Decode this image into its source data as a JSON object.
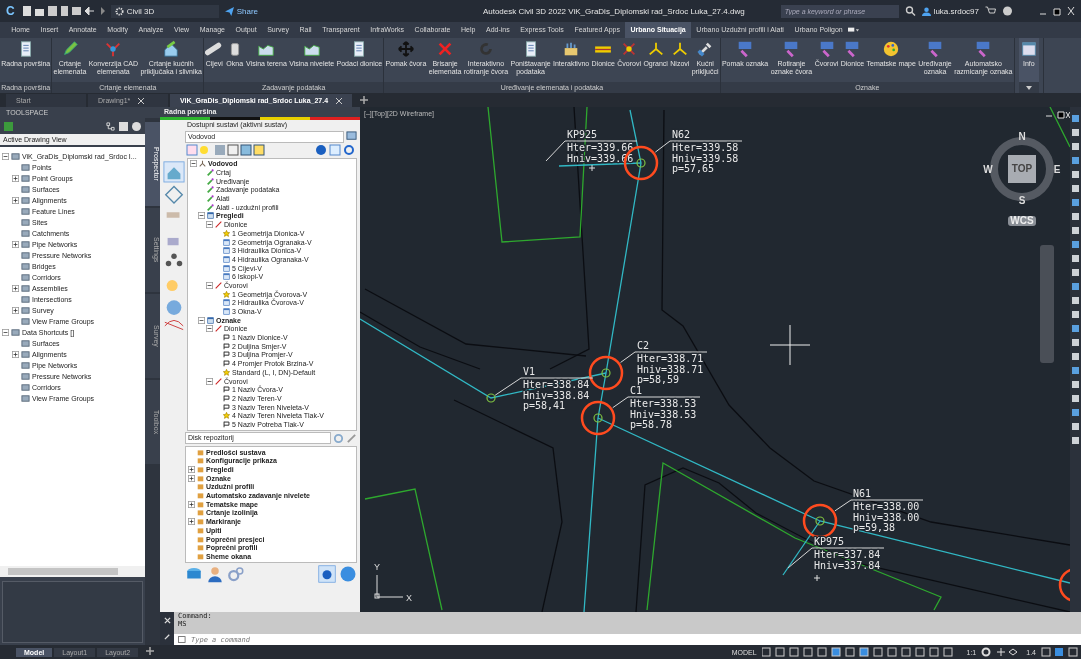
{
  "title_bar": {
    "app_badge": "C",
    "workspace": "Civil 3D",
    "share": "Share",
    "title": "Autodesk Civil 3D 2022   ViK_GraDis_Diplomski rad_Srdoc Luka_27.4.dwg",
    "search": {
      "placeholder": "Type a keyword or phrase"
    },
    "user": "luka.srdoc97"
  },
  "ribbon_tabs": [
    {
      "label": "Home",
      "selected": false
    },
    {
      "label": "Insert",
      "selected": false
    },
    {
      "label": "Annotate",
      "selected": false
    },
    {
      "label": "Modify",
      "selected": false
    },
    {
      "label": "Analyze",
      "selected": false
    },
    {
      "label": "View",
      "selected": false
    },
    {
      "label": "Manage",
      "selected": false
    },
    {
      "label": "Output",
      "selected": false
    },
    {
      "label": "Survey",
      "selected": false
    },
    {
      "label": "Rail",
      "selected": false
    },
    {
      "label": "Transparent",
      "selected": false
    },
    {
      "label": "InfraWorks",
      "selected": false
    },
    {
      "label": "Collaborate",
      "selected": false
    },
    {
      "label": "Help",
      "selected": false
    },
    {
      "label": "Add-ins",
      "selected": false
    },
    {
      "label": "Express Tools",
      "selected": false
    },
    {
      "label": "Featured Apps",
      "selected": false
    },
    {
      "label": "Urbano Situacija",
      "selected": true
    },
    {
      "label": "Urbano Uzdužni profili i Alati",
      "selected": false
    },
    {
      "label": "Urbano Poligon",
      "selected": false
    }
  ],
  "ribbon_panels": [
    {
      "title": "Radna površina",
      "buttons": [
        "Radna površina"
      ]
    },
    {
      "title": "Crtanje elemenata",
      "buttons": [
        "Crtanje\nelemenata",
        "Konverzija CAD\nelemenata",
        "Crtanje kućnih\npriključaka i slivnika"
      ]
    },
    {
      "title": "Zadavanje podataka",
      "buttons": [
        "Cijevi",
        "Okna",
        "Visina terena",
        "Visina nivelete",
        "Podaci dionice"
      ]
    },
    {
      "title": "Uređivanje elemenata i podataka",
      "buttons": [
        "Pomak čvora",
        "Brisanje\nelemenata",
        "Interaktivno\nrotiranje čvora",
        "Poništavanje\npodataka",
        "Interaktivno",
        "Dionice",
        "Čvorovi",
        "Ogranci",
        "Nizovi",
        "Kućni\npriključci"
      ]
    },
    {
      "title": "Oznake",
      "buttons": [
        "Pomak oznaka",
        "Rotiranje\noznake čvora",
        "Čvorovi",
        "Dionice",
        "Tematske mape",
        "Uređivanje\noznaka",
        "Automatsko\nrazmicanje oznaka"
      ]
    }
  ],
  "info_button": "Info",
  "document_tabs": [
    {
      "label": "Start",
      "selected": false,
      "closable": false
    },
    {
      "label": "Drawing1*",
      "selected": false,
      "closable": true
    },
    {
      "label": "ViK_GraDis_Diplomski rad_Srdoc Luka_27.4",
      "selected": true,
      "closable": true
    }
  ],
  "toolspace": {
    "title": "TOOLSPACE",
    "view": "Active Drawing View",
    "tree": [
      {
        "label": "ViK_GraDis_Diplomski rad_Srdoc I...",
        "collapsed": false,
        "children": [
          {
            "label": "Points",
            "collapsed": false
          },
          {
            "label": "Point Groups",
            "collapsed": true
          },
          {
            "label": "Surfaces",
            "collapsed": false
          },
          {
            "label": "Alignments",
            "collapsed": true
          },
          {
            "label": "Feature Lines",
            "collapsed": false
          },
          {
            "label": "Sites",
            "collapsed": false
          },
          {
            "label": "Catchments",
            "collapsed": false
          },
          {
            "label": "Pipe Networks",
            "collapsed": true
          },
          {
            "label": "Pressure Networks",
            "collapsed": false
          },
          {
            "label": "Bridges",
            "collapsed": false
          },
          {
            "label": "Corridors",
            "collapsed": false
          },
          {
            "label": "Assemblies",
            "collapsed": true
          },
          {
            "label": "Intersections",
            "collapsed": false
          },
          {
            "label": "Survey",
            "collapsed": true
          },
          {
            "label": "View Frame Groups",
            "collapsed": false
          }
        ]
      },
      {
        "label": "Data Shortcuts []",
        "collapsed": false,
        "children": [
          {
            "label": "Surfaces",
            "collapsed": false
          },
          {
            "label": "Alignments",
            "collapsed": true
          },
          {
            "label": "Pipe Networks",
            "collapsed": false
          },
          {
            "label": "Pressure Networks",
            "collapsed": false
          },
          {
            "label": "Corridors",
            "collapsed": false
          },
          {
            "label": "View Frame Groups",
            "collapsed": false
          }
        ]
      }
    ],
    "side_tabs": [
      {
        "label": "Prospector",
        "selected": true
      },
      {
        "label": "Settings",
        "selected": false
      },
      {
        "label": "Survey",
        "selected": false
      },
      {
        "label": "Toolbox",
        "selected": false
      }
    ]
  },
  "radna_povrsina": {
    "title": "Radna površina",
    "systems_label": "Dostupni sustavi (aktivni sustav)",
    "system": "Vodovod",
    "tree": [
      {
        "label": "Vodovod",
        "kind": "system",
        "children": [
          {
            "label": "Crtaj",
            "kind": "tool"
          },
          {
            "label": "Uređivanje",
            "kind": "tool"
          },
          {
            "label": "Zadavanje podataka",
            "kind": "tool"
          },
          {
            "label": "Alati",
            "kind": "tool"
          },
          {
            "label": "Alati - uzdužni profili",
            "kind": "tool"
          },
          {
            "label": "Pregledi",
            "kind": "group",
            "children": [
              {
                "label": "Dionice",
                "kind": "category",
                "children": [
                  {
                    "label": "1 Geometrija Dionica-V",
                    "kind": "view",
                    "default": true
                  },
                  {
                    "label": "2 Geometrija Ogranaka-V",
                    "kind": "view",
                    "default": false
                  },
                  {
                    "label": "3 Hidraulika Dionica-V",
                    "kind": "view",
                    "default": false
                  },
                  {
                    "label": "4 Hidraulika Ogranaka-V",
                    "kind": "view",
                    "default": false
                  },
                  {
                    "label": "5 Cijevi-V",
                    "kind": "view",
                    "default": false
                  },
                  {
                    "label": "6 Iskopi-V",
                    "kind": "view",
                    "default": false
                  }
                ]
              },
              {
                "label": "Čvorovi",
                "kind": "category",
                "children": [
                  {
                    "label": "1 Geometrija Čvorova-V",
                    "kind": "view",
                    "default": true
                  },
                  {
                    "label": "2 Hidraulika Čvorova-V",
                    "kind": "view",
                    "default": false
                  },
                  {
                    "label": "3 Okna-V",
                    "kind": "view",
                    "default": false
                  }
                ]
              }
            ]
          },
          {
            "label": "Oznake",
            "kind": "group",
            "children": [
              {
                "label": "Dionice",
                "kind": "category",
                "children": [
                  {
                    "label": "1 Naziv Dionice-V",
                    "kind": "label",
                    "default": false
                  },
                  {
                    "label": "2 Duljina Smjer-V",
                    "kind": "label",
                    "default": false
                  },
                  {
                    "label": "3 Duljina Promjer-V",
                    "kind": "label",
                    "default": false
                  },
                  {
                    "label": "4 Promjer Protok Brzina-V",
                    "kind": "label",
                    "default": false
                  },
                  {
                    "label": "Standard (L, I, DN)-Default",
                    "kind": "label",
                    "default": true
                  }
                ]
              },
              {
                "label": "Čvorovi",
                "kind": "category",
                "children": [
                  {
                    "label": "1 Naziv Čvora-V",
                    "kind": "label",
                    "default": false
                  },
                  {
                    "label": "2 Naziv Teren-V",
                    "kind": "label",
                    "default": false
                  },
                  {
                    "label": "3 Naziv Teren Niveleta-V",
                    "kind": "label",
                    "default": false
                  },
                  {
                    "label": "4 Naziv Teren Niveleta Tlak-V",
                    "kind": "label",
                    "default": true
                  },
                  {
                    "label": "5 Naziv Potreba Tlak-V",
                    "kind": "label",
                    "default": false
                  }
                ]
              }
            ]
          }
        ]
      }
    ],
    "repository": "Disk repozitorij",
    "repository_items": [
      {
        "label": "Predlošci sustava",
        "collapsed": false
      },
      {
        "label": "Konfiguracije prikaza",
        "collapsed": false
      },
      {
        "label": "Pregledi",
        "collapsed": true
      },
      {
        "label": "Oznake",
        "collapsed": true
      },
      {
        "label": "Uzdužni profili",
        "collapsed": false
      },
      {
        "label": "Automatsko zadavanje nivelete",
        "collapsed": false
      },
      {
        "label": "Tematske mape",
        "collapsed": true
      },
      {
        "label": "Crtanje izolinija",
        "collapsed": false
      },
      {
        "label": "Markiranje",
        "collapsed": true
      },
      {
        "label": "Upiti",
        "collapsed": false
      },
      {
        "label": "Poprečni presjeci",
        "collapsed": false
      },
      {
        "label": "Poprečni profili",
        "collapsed": false
      },
      {
        "label": "Sheme okana",
        "collapsed": false
      }
    ]
  },
  "canvas": {
    "viewport_label": "[–][Top][2D Wireframe]",
    "viewcube": {
      "top": "TOP",
      "north": "N",
      "south": "S",
      "east": "E",
      "west": "W",
      "ucs": "WCS"
    },
    "axes": {
      "x": "X",
      "y": "Y"
    },
    "nodes": [
      {
        "name": "KP925",
        "kind": "point",
        "highlighted": false,
        "lines": [
          "Hter=339.66",
          "Hniv=339.66"
        ]
      },
      {
        "name": "N62",
        "kind": "node",
        "highlighted": true,
        "lines": [
          "Hter=339.58",
          "Hniv=339.58",
          "p=57,65"
        ]
      },
      {
        "name": "C2",
        "kind": "node",
        "highlighted": true,
        "lines": [
          "Hter=338.71",
          "Hniv=338.71",
          "p=58,59"
        ]
      },
      {
        "name": "V1",
        "kind": "node",
        "highlighted": false,
        "lines": [
          "Hter=338.84",
          "Hniv=338.84",
          "p=58,41"
        ]
      },
      {
        "name": "C1",
        "kind": "node",
        "highlighted": true,
        "lines": [
          "Hter=338.53",
          "Hniv=338.53",
          "p=58.78"
        ]
      },
      {
        "name": "N61",
        "kind": "node",
        "highlighted": true,
        "lines": [
          "Hter=338.00",
          "Hniv=338.00",
          "p=59,38"
        ]
      },
      {
        "name": "KP975",
        "kind": "point",
        "highlighted": false,
        "lines": [
          "Hter=337.84",
          "Hniv=337.84"
        ]
      }
    ]
  },
  "command_line": {
    "history": [
      "Command:",
      "MS"
    ],
    "placeholder": "Type a command"
  },
  "status_bar": {
    "layouts": [
      {
        "label": "Model",
        "selected": true
      },
      {
        "label": "Layout1",
        "selected": false
      },
      {
        "label": "Layout2",
        "selected": false
      }
    ],
    "space": "MODEL",
    "scale": "1:1",
    "lineweight": "1.4"
  }
}
